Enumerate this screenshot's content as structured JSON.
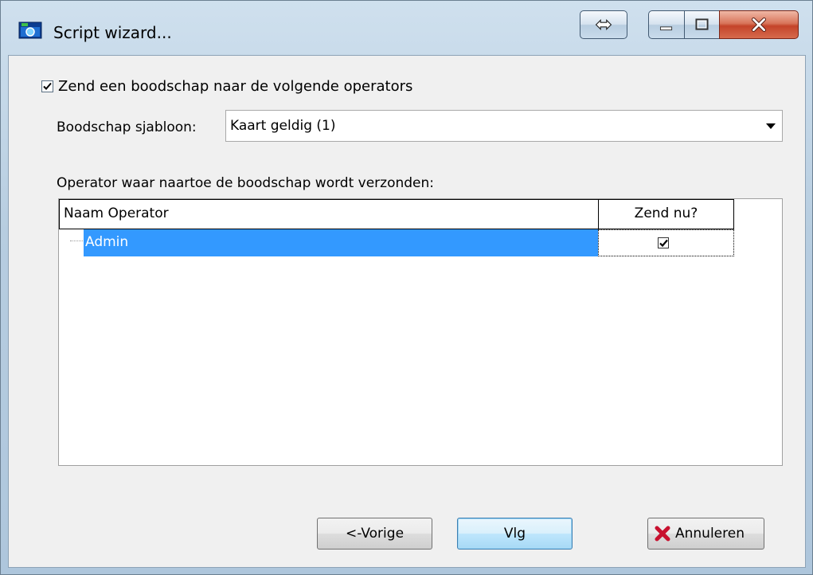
{
  "window": {
    "title": "Script wizard..."
  },
  "send_message": {
    "checked": true,
    "label": "Zend een boodschap naar de volgende operators"
  },
  "template": {
    "label": "Boodschap sjabloon:",
    "value": "Kaart geldig  (1)"
  },
  "operators": {
    "label": "Operator waar naartoe de boodschap wordt verzonden:",
    "columns": [
      "Naam Operator",
      "Zend nu?"
    ],
    "rows": [
      {
        "name": "Admin",
        "send_now": true,
        "selected": true
      }
    ]
  },
  "buttons": {
    "prev": "<-Vorige",
    "next": "Vlg",
    "cancel": "Annuleren"
  },
  "icons": {
    "app": "wizard-app-icon",
    "swap": "swap-arrows-icon",
    "minimize": "minimize-icon",
    "maximize": "maximize-icon",
    "close": "close-icon",
    "cancel": "red-x-icon"
  },
  "colors": {
    "selection": "#3399ff",
    "close_button": "#c4442a",
    "cancel_icon": "#c8102e"
  }
}
